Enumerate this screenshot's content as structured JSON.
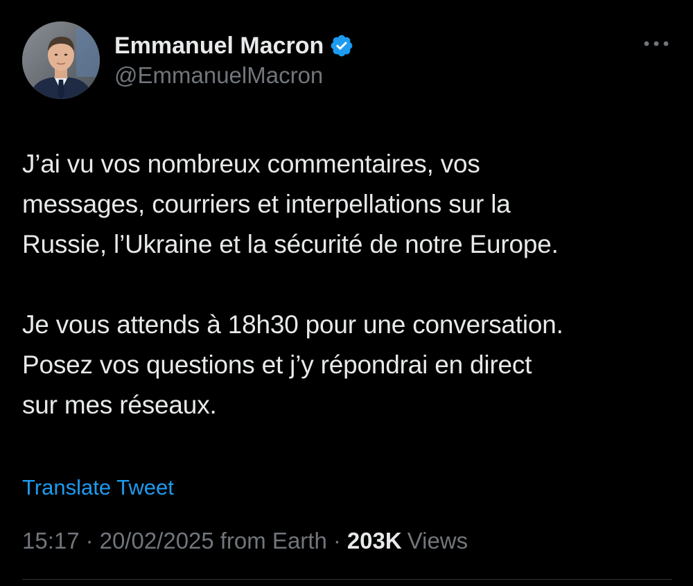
{
  "author": {
    "display_name": "Emmanuel Macron",
    "handle": "@EmmanuelMacron",
    "verified": true,
    "verified_color": "#1d9bf0"
  },
  "tweet": {
    "paragraphs": [
      "J’ai vu vos nombreux commentaires, vos\nmessages, courriers et interpellations sur la\nRussie, l’Ukraine et la sécurité de notre Europe.",
      "Je vous attends à 18h30 pour une conversation.\nPosez vos questions et j’y répondrai en direct\nsur mes réseaux."
    ],
    "translate_label": "Translate Tweet"
  },
  "meta": {
    "time": "15:17",
    "date": "20/02/2025",
    "source": "from Earth",
    "separator": "·",
    "views_count": "203K",
    "views_label": "Views"
  },
  "icons": {
    "avatar": "profile-photo",
    "verified": "verified-badge-icon",
    "more": "more-options-icon"
  },
  "colors": {
    "background": "#000000",
    "text": "#e7e9ea",
    "secondary": "#71767b",
    "accent": "#1d9bf0"
  }
}
